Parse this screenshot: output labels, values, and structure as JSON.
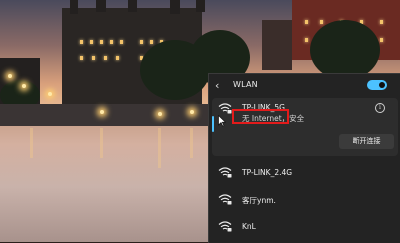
{
  "flyout": {
    "title": "WLAN",
    "back_icon": "chevron-left-icon",
    "wifi_toggle": "on"
  },
  "networks": [
    {
      "ssid": "TP-LINK_5G",
      "status": "无 Internet，安全",
      "connected": true,
      "action_label": "断开连接",
      "icon": "wifi-secured-icon"
    },
    {
      "ssid": "TP-LINK_2.4G",
      "icon": "wifi-secured-icon"
    },
    {
      "ssid": "客厅ynm.",
      "icon": "wifi-secured-icon"
    },
    {
      "ssid": "KnL",
      "icon": "wifi-secured-icon"
    }
  ],
  "colors": {
    "accent": "#4cc2ff",
    "panel_bg": "#232323",
    "highlight_box": "#e21b1b"
  }
}
